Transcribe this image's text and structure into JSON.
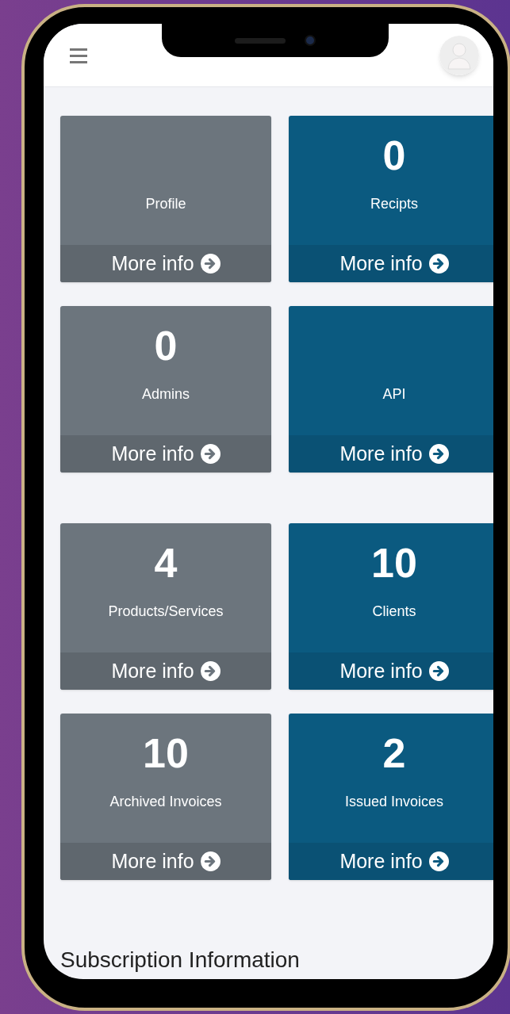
{
  "groups": [
    {
      "cards": [
        {
          "label": "Profile",
          "link": "More info",
          "color": "#6c757d"
        },
        {
          "count": "0",
          "label": "Recipts",
          "link": "More info",
          "color": "#0b5a80"
        },
        {
          "count": "0",
          "label": "Admins",
          "link": "More info",
          "color": "#6c757d"
        },
        {
          "label": "API",
          "link": "More info",
          "color": "#0b5a80"
        }
      ]
    },
    {
      "cards": [
        {
          "count": "4",
          "label": "Products/Services",
          "link": "More info",
          "color": "#6c757d"
        },
        {
          "count": "10",
          "label": "Clients",
          "link": "More info",
          "color": "#0b5a80"
        },
        {
          "count": "10",
          "label": "Archived Invoices",
          "link": "More info",
          "color": "#6c757d"
        },
        {
          "count": "2",
          "label": "Issued Invoices",
          "link": "More info",
          "color": "#0b5a80"
        }
      ]
    }
  ],
  "section_title": "Subscription Information"
}
